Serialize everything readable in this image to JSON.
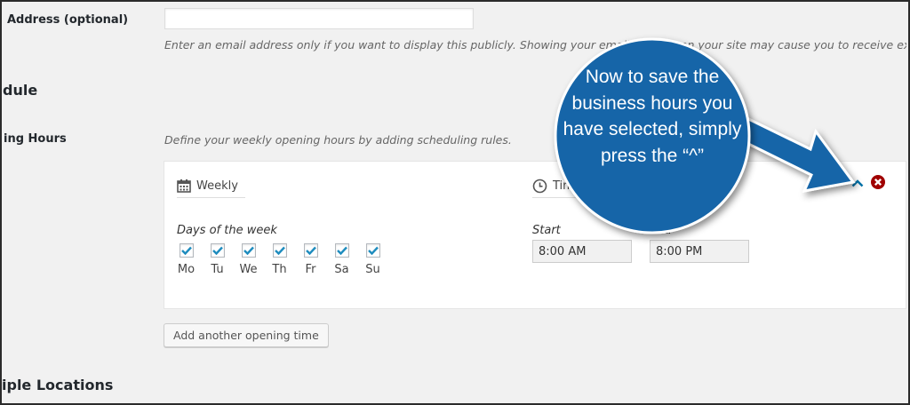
{
  "contact": {
    "email_label": "Address (optional)",
    "email_value": "",
    "email_help": "Enter an email address only if you want to display this publicly. Showing your email address on your site may cause you to receive excessive"
  },
  "schedule": {
    "section_title": "dule",
    "opening_hours_label": "ing Hours",
    "opening_hours_help": "Define your weekly opening hours by adding scheduling rules.",
    "rule": {
      "weekly_tab": "Weekly",
      "time_tab": "Time",
      "days_label": "Days of the week",
      "days": [
        {
          "label": "Mo",
          "checked": true
        },
        {
          "label": "Tu",
          "checked": true
        },
        {
          "label": "We",
          "checked": true
        },
        {
          "label": "Th",
          "checked": true
        },
        {
          "label": "Fr",
          "checked": true
        },
        {
          "label": "Sa",
          "checked": true
        },
        {
          "label": "Su",
          "checked": true
        }
      ],
      "start_label": "Start",
      "start_value": "8:00 AM",
      "end_label": "End",
      "end_value": "8:00 PM"
    },
    "add_button": "Add another opening time"
  },
  "locations": {
    "section_title": "iple Locations"
  },
  "annotation": {
    "text": "Now to save the business hours you have selected, simply press the “^”"
  },
  "colors": {
    "background": "#f1f1f1",
    "check": "#1e8cbe",
    "callout": "#1565a8",
    "remove": "#a00000",
    "collapse": "#0073aa"
  },
  "icons": {
    "weekly": "calendar-icon",
    "time": "clock-icon",
    "collapse": "chevron-up-icon",
    "remove": "remove-circle-icon"
  }
}
